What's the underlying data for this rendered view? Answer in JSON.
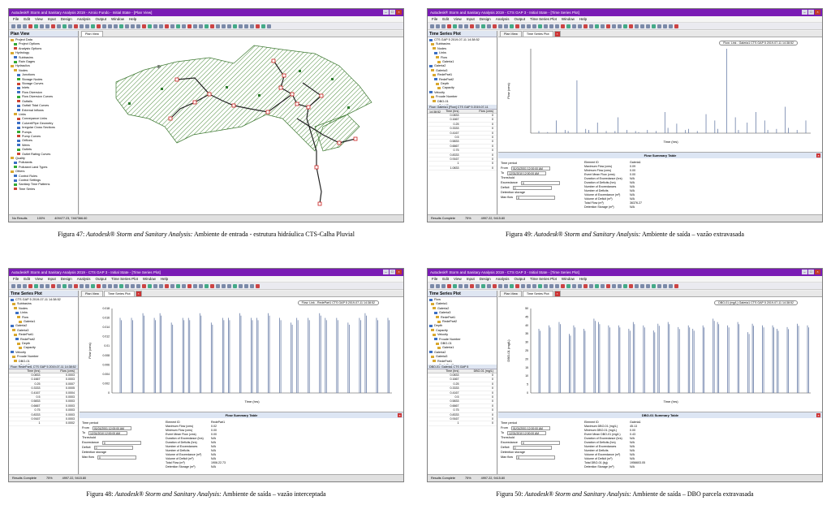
{
  "app": {
    "window_title_plan": "Autodesk® Storm and Sanitary Analysis 2019 - Arroio Fundo - Initial State - [Plan View]",
    "window_title_ts": "Autodesk® Storm and Sanitary Analysis 2019 - CTS GAP 3 - Initial State - [Time Series Plot]",
    "menus": [
      "File",
      "Edit",
      "View",
      "Input",
      "Design",
      "Analysis",
      "Output",
      "Time Series Plot",
      "Window",
      "Help"
    ],
    "plan_menus": [
      "File",
      "Edit",
      "View",
      "Input",
      "Design",
      "Analysis",
      "Output",
      "Window",
      "Help"
    ]
  },
  "fig47": {
    "caption_prefix": "Figura 47:",
    "caption_app": "Autodesk® Storm and Sanitary Analysis:",
    "caption_rest": "Ambiente de entrada - estrutura hidráulica CTS-Calha Pluvial",
    "panel_title": "Plan View",
    "tab": "Plan View",
    "tree": [
      "Project Data",
      "Project Options",
      "Analysis Options",
      "Hydrology",
      "Subbasins",
      "Rain Gages",
      "Hydraulics",
      "Nodes",
      "Junctions",
      "Storage Nodes",
      "Storage Curves",
      "Inlets",
      "Flow Diversion",
      "Flow Diversion Curves",
      "Outfalls",
      "Outfall Tidal Curves",
      "External Inflows",
      "Links",
      "Conveyance Links",
      "Culvert/Pipe Geometry",
      "Irregular Cross Sections",
      "Pumps",
      "Pump Curves",
      "Orifices",
      "Weirs",
      "Outlets",
      "Outlet Rating Curves",
      "Quality",
      "Pollutants",
      "Pollutant Land Types",
      "Others",
      "Control Rules",
      "Control Settings",
      "Sanitary Time Patterns",
      "Time Series"
    ],
    "status": [
      "No Results",
      "100%",
      "409477.23, 7467366.60"
    ]
  },
  "fig49": {
    "caption_prefix": "Figura 49:",
    "caption_app": "Autodesk® Storm and Sanitary Analysis:",
    "caption_rest": "Ambiente de saída – vazão extravasada",
    "legend": "Flow: Link - Galeria1 CTS GAP 5 2019-07-11 14:38:52",
    "tabs": [
      "Plan View",
      "Time Series Plot"
    ],
    "tree": [
      "CTS GAP 5 2019-07-11 14:38:52",
      "Subbasins",
      "Nodes",
      "Links",
      "Flow",
      "Galeria1",
      "Galeria2",
      "Galeria3",
      "RedePart1",
      "RedePart2",
      "Depth",
      "Capacity",
      "Velocity",
      "Froude Number",
      "DBO-01",
      "Total P",
      "System"
    ],
    "table_head": "Flow: Galeria1 [Flow] CTS GAP 5 2019-07-11 14:38:52",
    "cols": [
      "Time (hrs)",
      "Flow (cms)"
    ],
    "rows": [
      [
        "0.0833",
        "0"
      ],
      [
        "0.1667",
        "0"
      ],
      [
        "0.25",
        "0"
      ],
      [
        "0.3333",
        "0"
      ],
      [
        "0.4167",
        "0"
      ],
      [
        "0.5",
        "0"
      ],
      [
        "0.5833",
        "0"
      ],
      [
        "0.6667",
        "0"
      ],
      [
        "0.75",
        "0"
      ],
      [
        "0.8333",
        "0"
      ],
      [
        "0.9167",
        "0"
      ],
      [
        "1",
        "0"
      ],
      [
        "1.0833",
        "0"
      ]
    ],
    "summary_title": "Flow Summary Table",
    "left": {
      "period": "Time period",
      "from_l": "From",
      "from": "01/01/2001 12:00:00 AM",
      "to_l": "To",
      "to": "12/31/2010 12:00:00 AM",
      "threshold": "Threshold",
      "exceed_l": "Exceedance",
      "exceed": "0",
      "deficit_l": "Deficit",
      "deficit": "0",
      "det": "Detention storage",
      "max_l": "Max flow",
      "max": "0"
    },
    "right": [
      [
        "Element ID",
        "Galeria1"
      ],
      [
        "Maximum Flow (cms)",
        "0.09"
      ],
      [
        "Minimum Flow (cms)",
        "0.00"
      ],
      [
        "Event Mean Flow (cms)",
        "0.00"
      ],
      [
        "Duration of Exceedance (hrs)",
        "N/A"
      ],
      [
        "Duration of Deficits (hrs)",
        "N/A"
      ],
      [
        "Number of Exceedances",
        "N/A"
      ],
      [
        "Number of Deficits",
        "N/A"
      ],
      [
        "Volume of Exceedance (m³)",
        "N/A"
      ],
      [
        "Volume of Deficit (m³)",
        "N/A"
      ],
      [
        "Total Flow (m³)",
        "36376.27"
      ],
      [
        "Detention Storage (m³)",
        "N/A"
      ]
    ],
    "status": [
      "Results Complete",
      "75%",
      "4997.22, 9415.80"
    ],
    "ylabel": "Flow (cms)",
    "xlabel": "Time (hrs)"
  },
  "fig48": {
    "caption_prefix": "Figura 48:",
    "caption_app": "Autodesk® Storm and Sanitary Analysis:",
    "caption_rest": "Ambiente de saída – vazão interceptada",
    "legend": "Flow: Link - RedePart1 CTS GAP 5 2019-07-11 14:38:52",
    "tabs": [
      "Plan View",
      "Time Series Plot"
    ],
    "tree": [
      "CTS GAP 5 2019-07-11 14:38:52",
      "Subbasins",
      "Nodes",
      "Links",
      "Flow",
      "Galeria1",
      "Galeria2",
      "Galeria3",
      "RedePart1",
      "RedePart2",
      "Depth",
      "Capacity",
      "Velocity",
      "Froude Number",
      "DBO-01",
      "Total P",
      "System"
    ],
    "table_head": "Flow: RedePart1 CTS GAP 5 2019-07-11 14:38:52",
    "cols": [
      "Time (hrs)",
      "Flow (cms)"
    ],
    "rows": [
      [
        "0.0833",
        "0.0003"
      ],
      [
        "0.1667",
        "0.0003"
      ],
      [
        "0.25",
        "0.0007"
      ],
      [
        "0.3333",
        "0.0005"
      ],
      [
        "0.4167",
        "0.0004"
      ],
      [
        "0.5",
        "0.0003"
      ],
      [
        "0.5833",
        "0.0003"
      ],
      [
        "0.6667",
        "0.0003"
      ],
      [
        "0.75",
        "0.0003"
      ],
      [
        "0.8333",
        "0.0003"
      ],
      [
        "0.9167",
        "0.0003"
      ],
      [
        "1",
        "0.0002"
      ]
    ],
    "summary_title": "Flow Summary Table",
    "left": {
      "period": "Time period",
      "from_l": "From",
      "from": "01/01/2001 12:00:00 AM",
      "to_l": "To",
      "to": "12/31/2010 12:00:00 AM",
      "threshold": "Threshold",
      "exceed_l": "Exceedance",
      "exceed": "0",
      "deficit_l": "Deficit",
      "deficit": "0",
      "det": "Detention storage",
      "max_l": "Max flow",
      "max": "0"
    },
    "right": [
      [
        "Element ID",
        "RedePart1"
      ],
      [
        "Maximum Flow (cms)",
        "0.02"
      ],
      [
        "Minimum Flow (cms)",
        "0.00"
      ],
      [
        "Event Mean Flow (cms)",
        "0.00"
      ],
      [
        "Duration of Exceedance (hrs)",
        "N/A"
      ],
      [
        "Duration of Deficits (hrs)",
        "N/A"
      ],
      [
        "Number of Exceedances",
        "N/A"
      ],
      [
        "Number of Deficits",
        "N/A"
      ],
      [
        "Volume of Exceedance (m³)",
        "N/A"
      ],
      [
        "Volume of Deficit (m³)",
        "N/A"
      ],
      [
        "Total Flow (m³)",
        "1906.22.73"
      ],
      [
        "Detention Storage (m³)",
        "N/A"
      ]
    ],
    "status": [
      "Results Complete",
      "75%",
      "4997.22, 9415.80"
    ],
    "ylabel": "Flow (cms)",
    "xlabel": "Time (hrs)",
    "yticks": [
      "0.018",
      "0.016",
      "0.014",
      "0.012",
      "0.01",
      "0.008",
      "0.006",
      "0.004",
      "0.002",
      "0"
    ]
  },
  "fig50": {
    "caption_prefix": "Figura 50:",
    "caption_app": "Autodesk® Storm and Sanitary Analysis:",
    "caption_rest": "Ambiente de saída – DBO parcela extravasada",
    "legend": "DBO-01 (mg/L) Galeria1 CTS GAP 5 2019-07-11 14:38:52",
    "tabs": [
      "Plan View",
      "Time Series Plot"
    ],
    "tree": [
      "Flow",
      "Galeria1",
      "Galeria2",
      "Galeria3",
      "RedePart1",
      "RedePart2",
      "Depth",
      "Capacity",
      "Velocity",
      "Froude Number",
      "DBO-01",
      "Galeria1",
      "Galeria2",
      "Galeria3",
      "RedePart1",
      "RedePart2",
      "Total P",
      "System"
    ],
    "table_head": "DBO-01: Galeria1 CTS GAP 5",
    "cols": [
      "Time (hrs)",
      "DBO-01 (mg/L)"
    ],
    "rows": [
      [
        "0.0833",
        "0"
      ],
      [
        "0.1667",
        "0"
      ],
      [
        "0.25",
        "0"
      ],
      [
        "0.3333",
        "0"
      ],
      [
        "0.4167",
        "0"
      ],
      [
        "0.5",
        "0"
      ],
      [
        "0.5833",
        "0"
      ],
      [
        "0.6667",
        "0"
      ],
      [
        "0.75",
        "0"
      ],
      [
        "0.8333",
        "0"
      ],
      [
        "0.9167",
        "0"
      ],
      [
        "1",
        "0"
      ]
    ],
    "summary_title": "DBO-01 Summary Table",
    "left": {
      "period": "Time period",
      "from_l": "From",
      "from": "01/01/2001 12:00:00 AM",
      "to_l": "To",
      "to": "12/31/2010 12:00:00 AM",
      "threshold": "Threshold",
      "exceed_l": "Exceedance",
      "exceed": "0",
      "deficit_l": "Deficit",
      "deficit": "0",
      "det": "Detention storage",
      "max_l": "Max flow",
      "max": "0"
    },
    "right": [
      [
        "Element ID",
        "Galeria1"
      ],
      [
        "Maximum DBO-01 (mg/L)",
        "45.13"
      ],
      [
        "Minimum DBO-01 (mg/L)",
        "0.00"
      ],
      [
        "Event Mean DBO-01 (mg/L)",
        "0.43"
      ],
      [
        "Duration of Exceedance (hrs)",
        "N/A"
      ],
      [
        "Duration of Deficits (hrs)",
        "N/A"
      ],
      [
        "Number of Exceedances",
        "N/A"
      ],
      [
        "Number of Deficits",
        "N/A"
      ],
      [
        "Volume of Exceedance (m³)",
        "N/A"
      ],
      [
        "Volume of Deficit (m³)",
        "N/A"
      ],
      [
        "Total DBO-01 (kg)",
        "1956603.05"
      ],
      [
        "Detention Storage (m³)",
        "N/A"
      ]
    ],
    "status": [
      "Results Complete",
      "75%",
      "4997.22, 9415.80"
    ],
    "ylabel": "DBO-01 (mg/L)",
    "xlabel": "Time (hrs)",
    "yticks": [
      "50",
      "45",
      "40",
      "35",
      "30",
      "25",
      "20",
      "15",
      "10",
      "5",
      "0"
    ]
  },
  "chart_data": [
    {
      "type": "bar",
      "title": "",
      "xlabel": "Time (hrs)",
      "ylabel": "Flow (cms)",
      "series": [
        {
          "name": "Flow: Link - Galeria1 CTS GAP 5 2019-07-11 14:38:52",
          "spikes": [
            0.002,
            0.001,
            0.012,
            0.003,
            0.002,
            0.05,
            0.004,
            0.003,
            0.01,
            0.002,
            0.002,
            0.015,
            0.003,
            0.002,
            0.001,
            0.003,
            0.002,
            0.02,
            0.005,
            0.009,
            0.003,
            0.004,
            0.002,
            0.018,
            0.012,
            0.004,
            0.08,
            0.015,
            0.003,
            0.01,
            0.02,
            0.012,
            0.003,
            0.004,
            0.025,
            0.005,
            0.003,
            0.012
          ]
        }
      ]
    },
    {
      "type": "bar",
      "title": "",
      "xlabel": "Time (hrs)",
      "ylabel": "Flow (cms)",
      "ylim": [
        0,
        0.018
      ],
      "series": [
        {
          "name": "Flow: Link - RedePart1 CTS GAP 5 2019-07-11 14:38:52",
          "spikes": [
            0.016,
            0.016,
            0.017,
            0.016,
            0.017,
            0.015,
            0.016,
            0.016,
            0.017,
            0.015,
            0.016,
            0.016,
            0.017,
            0.016,
            0.016,
            0.017,
            0.016,
            0.015,
            0.016,
            0.016,
            0.017,
            0.016,
            0.016,
            0.015,
            0.016,
            0.017,
            0.016,
            0.016
          ]
        }
      ]
    },
    {
      "type": "bar",
      "title": "",
      "xlabel": "Time (hrs)",
      "ylabel": "DBO-01 (mg/L)",
      "ylim": [
        0,
        50
      ],
      "series": [
        {
          "name": "DBO-01 (mg/L) Galeria1 CTS GAP 5 2019-07-11 14:38:52",
          "spikes": [
            38,
            40,
            42,
            35,
            40,
            38,
            44,
            42,
            40,
            40,
            38,
            42,
            40,
            37,
            41,
            42,
            39,
            40,
            38,
            40,
            44,
            42,
            40,
            42,
            36,
            41,
            40,
            40,
            38,
            39,
            41,
            40
          ]
        }
      ]
    }
  ]
}
